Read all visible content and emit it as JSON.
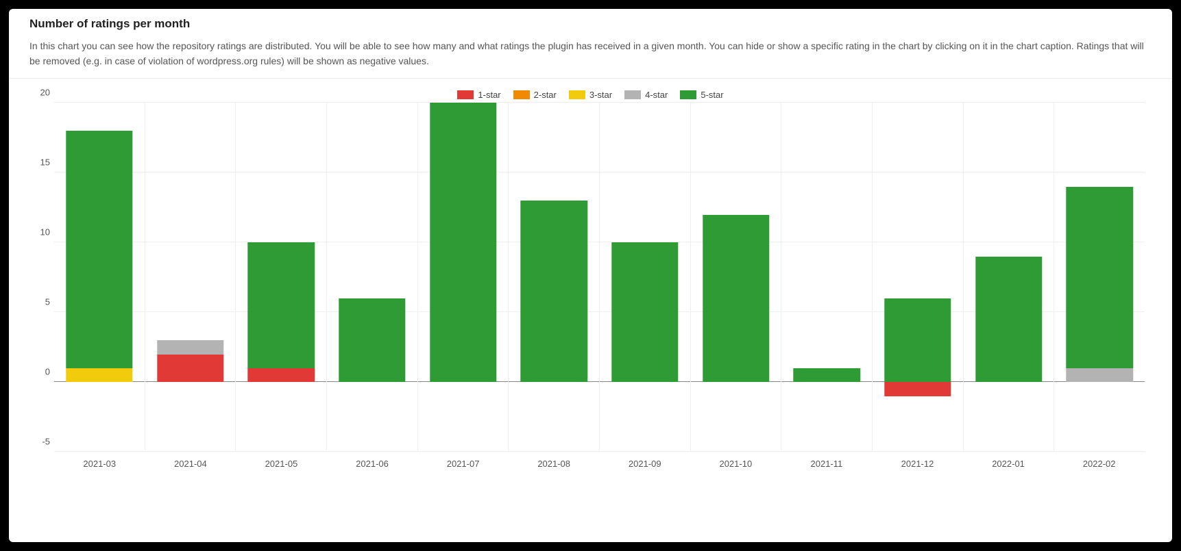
{
  "header": {
    "title": "Number of ratings per month",
    "description": "In this chart you can see how the repository ratings are distributed. You will be able to see how many and what ratings the plugin has received in a given month. You can hide or show a specific rating in the chart by clicking on it in the chart caption. Ratings that will be removed (e.g. in case of violation of wordpress.org rules) will be shown as negative values."
  },
  "legend": {
    "items": [
      {
        "key": "1-star",
        "label": "1-star",
        "color": "#e13a36"
      },
      {
        "key": "2-star",
        "label": "2-star",
        "color": "#f18a00"
      },
      {
        "key": "3-star",
        "label": "3-star",
        "color": "#f2cc0c"
      },
      {
        "key": "4-star",
        "label": "4-star",
        "color": "#b3b3b3"
      },
      {
        "key": "5-star",
        "label": "5-star",
        "color": "#2f9b35"
      }
    ]
  },
  "chart_data": {
    "type": "bar",
    "stacked": true,
    "title": "Number of ratings per month",
    "xlabel": "",
    "ylabel": "",
    "ylim": [
      -5,
      20
    ],
    "yticks": [
      -5,
      0,
      5,
      10,
      15,
      20
    ],
    "categories": [
      "2021-03",
      "2021-04",
      "2021-05",
      "2021-06",
      "2021-07",
      "2021-08",
      "2021-09",
      "2021-10",
      "2021-11",
      "2021-12",
      "2022-01",
      "2022-02"
    ],
    "series": [
      {
        "name": "1-star",
        "color": "#e13a36",
        "values": [
          0,
          2,
          1,
          0,
          0,
          0,
          0,
          0,
          0,
          -1,
          0,
          0
        ]
      },
      {
        "name": "2-star",
        "color": "#f18a00",
        "values": [
          0,
          0,
          0,
          0,
          0,
          0,
          0,
          0,
          0,
          0,
          0,
          0
        ]
      },
      {
        "name": "3-star",
        "color": "#f2cc0c",
        "values": [
          1,
          0,
          0,
          0,
          0,
          0,
          0,
          0,
          0,
          0,
          0,
          0
        ]
      },
      {
        "name": "4-star",
        "color": "#b3b3b3",
        "values": [
          0,
          1,
          0,
          0,
          0,
          0,
          0,
          0,
          0,
          0,
          0,
          1
        ]
      },
      {
        "name": "5-star",
        "color": "#2f9b35",
        "values": [
          17,
          0,
          9,
          6,
          20,
          13,
          10,
          12,
          1,
          6,
          9,
          13
        ]
      }
    ]
  }
}
